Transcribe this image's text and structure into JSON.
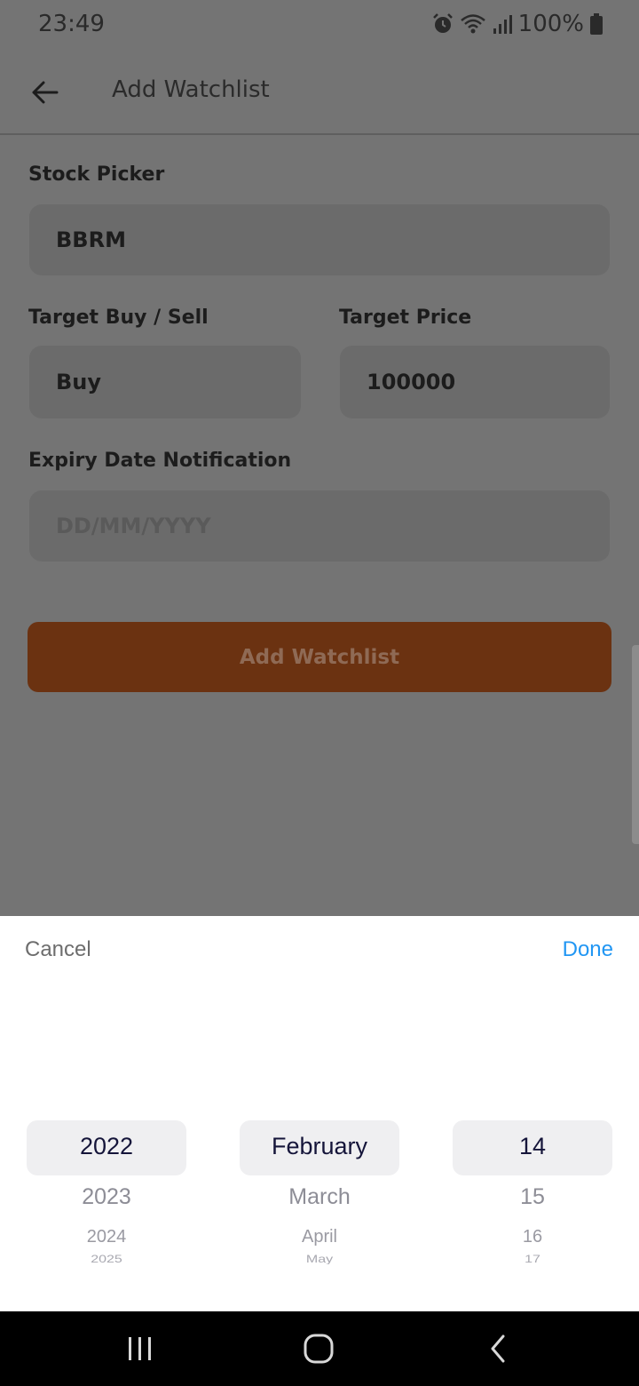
{
  "status_bar": {
    "time": "23:49",
    "battery": "100%"
  },
  "app_bar": {
    "title": "Add Watchlist"
  },
  "form": {
    "stock_picker": {
      "label": "Stock Picker",
      "value": "BBRM"
    },
    "target_buy_sell": {
      "label": "Target Buy / Sell",
      "value": "Buy"
    },
    "target_price": {
      "label": "Target Price",
      "value": "100000"
    },
    "expiry_date": {
      "label": "Expiry Date Notification",
      "placeholder": "DD/MM/YYYY"
    },
    "submit_label": "Add Watchlist"
  },
  "date_picker": {
    "cancel_label": "Cancel",
    "done_label": "Done",
    "year": {
      "selected": "2022",
      "next": [
        "2023",
        "2024",
        "2025"
      ]
    },
    "month": {
      "selected": "February",
      "next": [
        "March",
        "April",
        "May"
      ]
    },
    "day": {
      "selected": "14",
      "next": [
        "15",
        "16",
        "17"
      ]
    }
  },
  "colors": {
    "accent": "#6b3211",
    "done_blue": "#2196f3",
    "overlay": "#747474"
  }
}
